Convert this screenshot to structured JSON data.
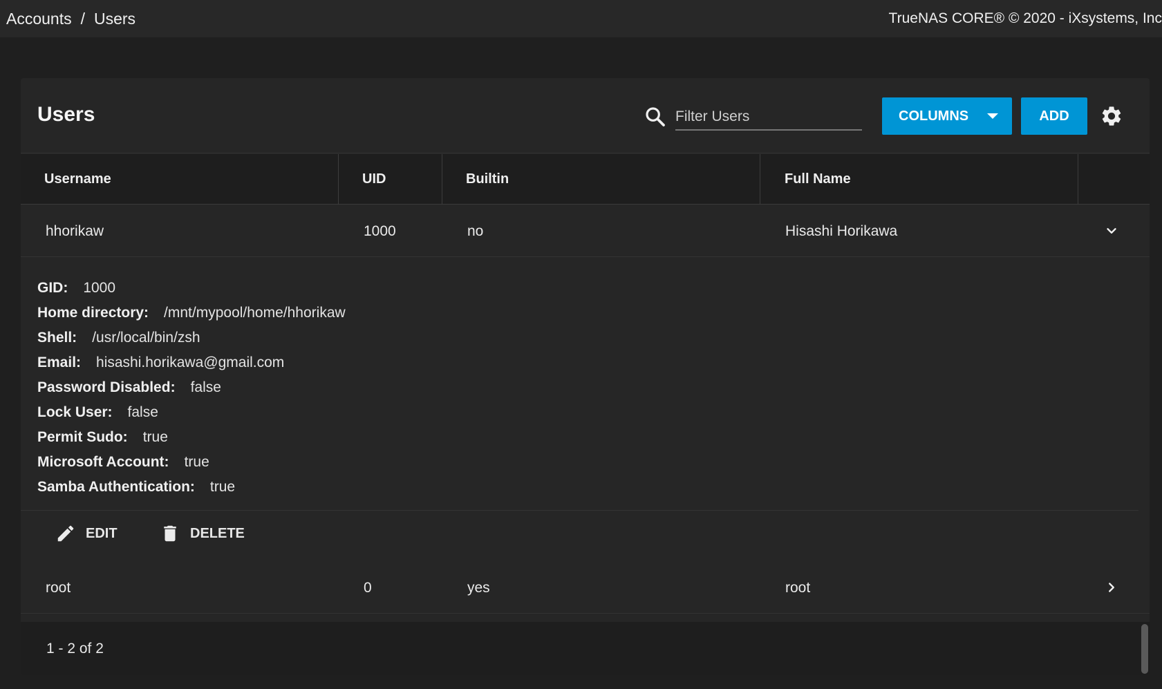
{
  "breadcrumb": {
    "parent": "Accounts",
    "separator": "/",
    "current": "Users"
  },
  "copyright": "TrueNAS CORE® © 2020 - iXsystems, Inc",
  "card": {
    "title": "Users",
    "search": {
      "placeholder": "Filter Users",
      "value": ""
    },
    "columns_label": "COLUMNS",
    "add_label": "ADD"
  },
  "table": {
    "headers": {
      "username": "Username",
      "uid": "UID",
      "builtin": "Builtin",
      "full_name": "Full Name"
    },
    "rows": [
      {
        "username": "hhorikaw",
        "uid": "1000",
        "builtin": "no",
        "full_name": "Hisashi Horikawa",
        "expanded": true
      },
      {
        "username": "root",
        "uid": "0",
        "builtin": "yes",
        "full_name": "root",
        "expanded": false
      }
    ]
  },
  "details": [
    {
      "label": "GID:",
      "value": "1000"
    },
    {
      "label": "Home directory:",
      "value": "/mnt/mypool/home/hhorikaw"
    },
    {
      "label": "Shell:",
      "value": "/usr/local/bin/zsh"
    },
    {
      "label": "Email:",
      "value": "hisashi.horikawa@gmail.com"
    },
    {
      "label": "Password Disabled:",
      "value": "false"
    },
    {
      "label": "Lock User:",
      "value": "false"
    },
    {
      "label": "Permit Sudo:",
      "value": "true"
    },
    {
      "label": "Microsoft Account:",
      "value": "true"
    },
    {
      "label": "Samba Authentication:",
      "value": "true"
    }
  ],
  "actions": {
    "edit_label": "EDIT",
    "delete_label": "DELETE"
  },
  "pagination": "1 - 2 of 2",
  "colors": {
    "accent": "#0095d5",
    "background": "#1f1f1f",
    "card": "#262626"
  }
}
